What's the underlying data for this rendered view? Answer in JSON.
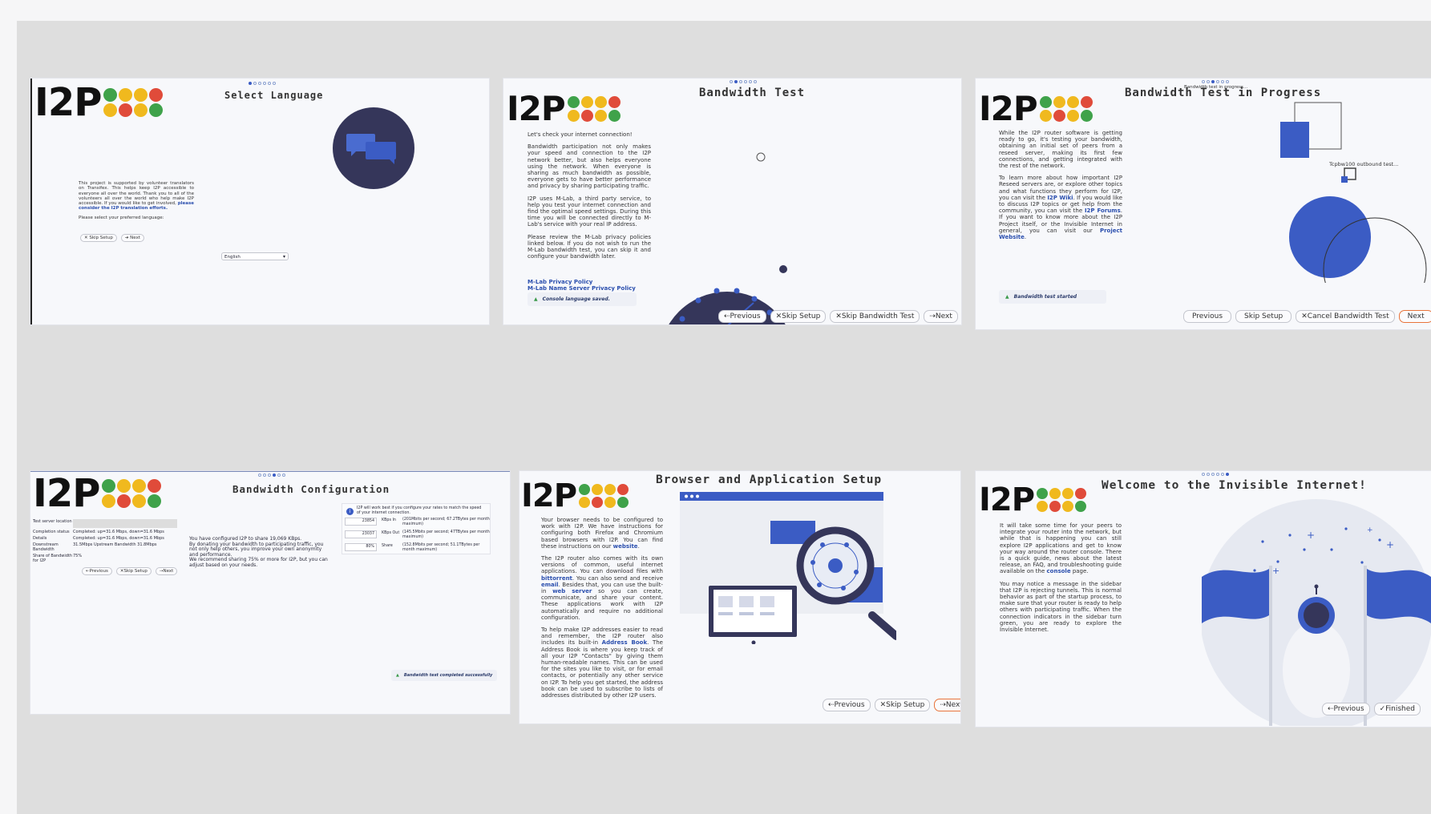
{
  "logo_text": "I2P",
  "logo_colors": [
    "#3fa24a",
    "#f0b91e",
    "#f0b91e",
    "#e04b3a",
    "#f0b91e",
    "#e04b3a",
    "#f0b91e",
    "#3fa24a"
  ],
  "colors": {
    "accent_blue": "#3b5cc4",
    "navy": "#35365a",
    "orange": "#e8733a",
    "status_green": "#3a9a4a"
  },
  "icons": [
    "chat-bubbles-icon",
    "speedometer-icon",
    "warning-triangle-icon",
    "magnifier-icon",
    "astronaut-icon"
  ],
  "panels": {
    "p1": {
      "title": "Select Language",
      "text1": "This project is supported by volunteer translators on Transifex. This helps keep I2P accessible to everyone all over the world. Thank you to all of the volunteers all over the world who help make I2P accessible. If you would like to get involved,",
      "link": "please consider the I2P translation efforts.",
      "text2": "Please select your preferred language:",
      "skip": "✕ Skip Setup",
      "next": "➔ Next",
      "language": "English"
    },
    "p2": {
      "title": "Bandwidth Test",
      "para1": "Let's check your internet connection!",
      "para2": "Bandwidth participation not only makes your speed and connection to the I2P network better, but also helps everyone using the network. When everyone is sharing as much bandwidth as possible, everyone gets to have better performance and privacy by sharing participating traffic.",
      "para3": "I2P uses M-Lab, a third party service, to help you test your internet connection and find the optimal speed settings. During this time you will be connected directly to M-Lab's service with your real IP address.",
      "para4": "Please review the M-Lab privacy policies linked below. If you do not wish to run the M-Lab bandwidth test, you can skip it and configure your bandwidth later.",
      "link1": "M-Lab Privacy Policy",
      "link2": "M-Lab Name Server Privacy Policy",
      "status": "Console language saved.",
      "prev": "⇠Previous",
      "skip": "✕Skip Setup",
      "skip_bw": "✕Skip Bandwidth Test",
      "next": "⇢Next"
    },
    "p3": {
      "title": "Bandwidth Test in Progress",
      "overlay": "Bandwidth test in progress...",
      "para1": "While the I2P router software is getting ready to go, it's testing your bandwidth, obtaining an initial set of peers from a reseed server, making its first few connections, and getting integrated with the rest of the network.",
      "para2a": "To learn more about how important I2P Reseed servers are, or explore other topics and what functions they perform for I2P, you can visit the",
      "link_wiki": "I2P Wiki",
      "para2b": ". If you would like to discuss I2P topics or get help from the community, you can visit the",
      "link_forums": "I2P Forums",
      "para2c": ". If you want to know more about the I2P Project itself, or the Invisible Internet in general, you can visit our",
      "link_site": "Project Website",
      "para2d": ".",
      "test_label": "Tcpbw100 outbound test...",
      "status": "Bandwidth test started",
      "prev": "Previous",
      "skip": "Skip Setup",
      "cancel": "✕Cancel Bandwidth Test",
      "next": "Next"
    },
    "p4": {
      "title": "Bandwidth Configuration",
      "rows": [
        {
          "label": "Test server location",
          "value": ""
        },
        {
          "label": "Completion status",
          "value": "Completed: up=31.6 Mbps, down=31.6 Mbps"
        },
        {
          "label": "Details",
          "value": "Completed: up=31.6 Mbps, down=31.6 Mbps"
        },
        {
          "label": "Downstream Bandwidth",
          "value": "31.5Mbps    Upstream Bandwidth   31.8Mbps"
        },
        {
          "label": "Share of Bandwidth for I2P",
          "value": "75%"
        }
      ],
      "summary1": "You have configured I2P to share 19,069 KBps.",
      "summary2": "By donating your bandwidth to participating traffic, you not only help others, you improve your own anonymity and performance.",
      "summary3": "We recommend sharing 75% or more for I2P, but you can adjust based on your needs.",
      "info": "I2P will work best if you configure your rates to match the speed of your internet connection.",
      "in_value": "23854",
      "in_label": "KBps In",
      "in_desc": "(201Mbits per second; 67.2TBytes per month maximum)",
      "out_value": "23037",
      "out_label": "KBps Out",
      "out_desc": "(145.5Mbits per second; 47TBytes per month maximum)",
      "share_value": "80%",
      "share_label": "Share",
      "share_desc": "(152.8Mbits per second; 51.1TBytes per month maximum)",
      "prev": "⇠Previous",
      "skip": "✕Skip Setup",
      "next": "⇢Next",
      "status": "Bandwidth test completed successfully"
    },
    "p5": {
      "title": "Browser and Application Setup",
      "para1a": "Your browser needs to be configured to work with I2P. We have instructions for configuring both Firefox and Chromium based browsers with I2P. You can find these instructions on our",
      "link_web": "website",
      "para1b": ".",
      "para2a": "The I2P router also comes with its own versions of common, useful internet applications. You can download files with",
      "link_bt": "bittorrent",
      "para2b": ". You can also send and receive",
      "link_email": "email",
      "para2c": ". Besides that, you can use the built-in",
      "link_ws": "web server",
      "para2d": "so you can create, communicate, and share your content. These applications work with I2P automatically and require no additional configuration.",
      "para3a": "To help make I2P addresses easier to read and remember, the I2P router also includes its built-in",
      "link_ab": "Address Book",
      "para3b": ". The Address Book is where you keep track of all your I2P \"Contacts\" by giving them human-readable names. This can be used for the sites you like to visit, or for email contacts, or potentially any other service on I2P. To help you get started, the address book can be used to subscribe to lists of addresses distributed by other I2P users.",
      "prev": "⇠Previous",
      "skip": "✕Skip Setup",
      "next": "⇢Next"
    },
    "p6": {
      "title": "Welcome to the Invisible Internet!",
      "para1a": "It will take some time for your peers to integrate your router into the network, but while that is happening you can still explore I2P applications and get to know your way around the router console. There is a quick guide, news about the latest release, an FAQ, and troubleshooting guide available on the",
      "link_console": "console",
      "para1b": "page.",
      "para2": "You may notice a message in the sidebar that I2P is rejecting tunnels. This is normal behavior as part of the startup process, to make sure that your router is ready to help others with participating traffic. When the connection indicators in the sidebar turn green, you are ready to explore the Invisible Internet.",
      "prev": "⇠Previous",
      "finish": "✓Finished"
    }
  }
}
